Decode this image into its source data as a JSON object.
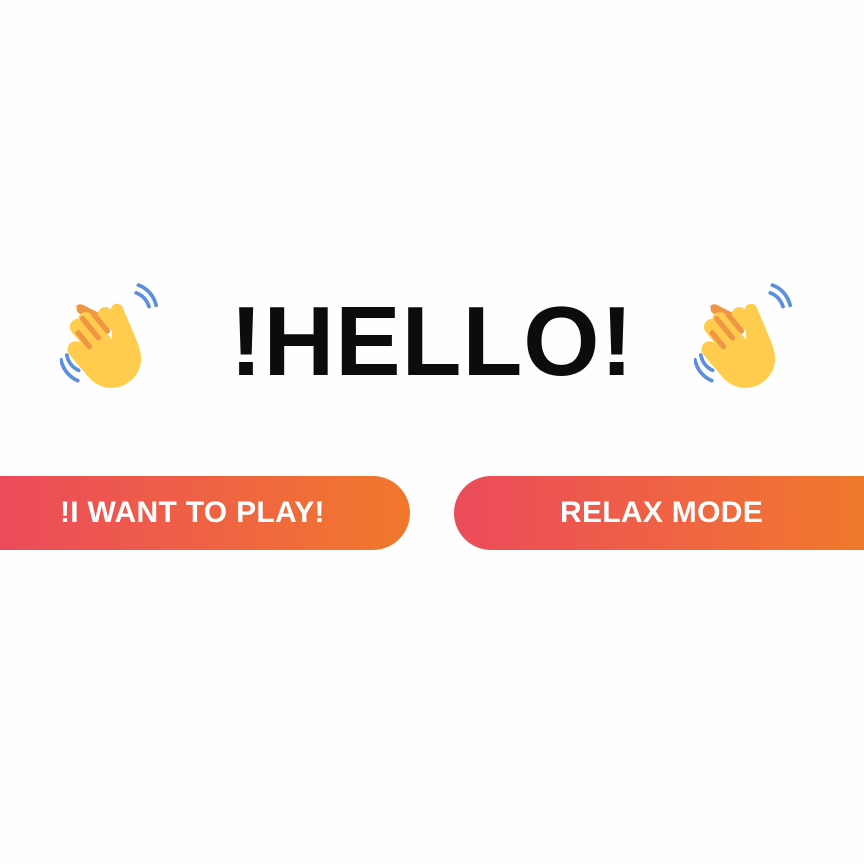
{
  "headline": {
    "text": "!HELLO!",
    "decor_icon": "waving-hand-icon"
  },
  "buttons": {
    "play_label": "!I WANT TO PLAY!",
    "relax_label": "RELAX MODE"
  },
  "colors": {
    "text": "#0c0c0c",
    "button_gradient_start": "#eb4b5b",
    "button_gradient_end": "#f0792c",
    "button_text": "#ffffff",
    "hand_fill": "#ffcc4d",
    "hand_shade": "#ef9645",
    "motion_lines": "#5c8fdc"
  }
}
